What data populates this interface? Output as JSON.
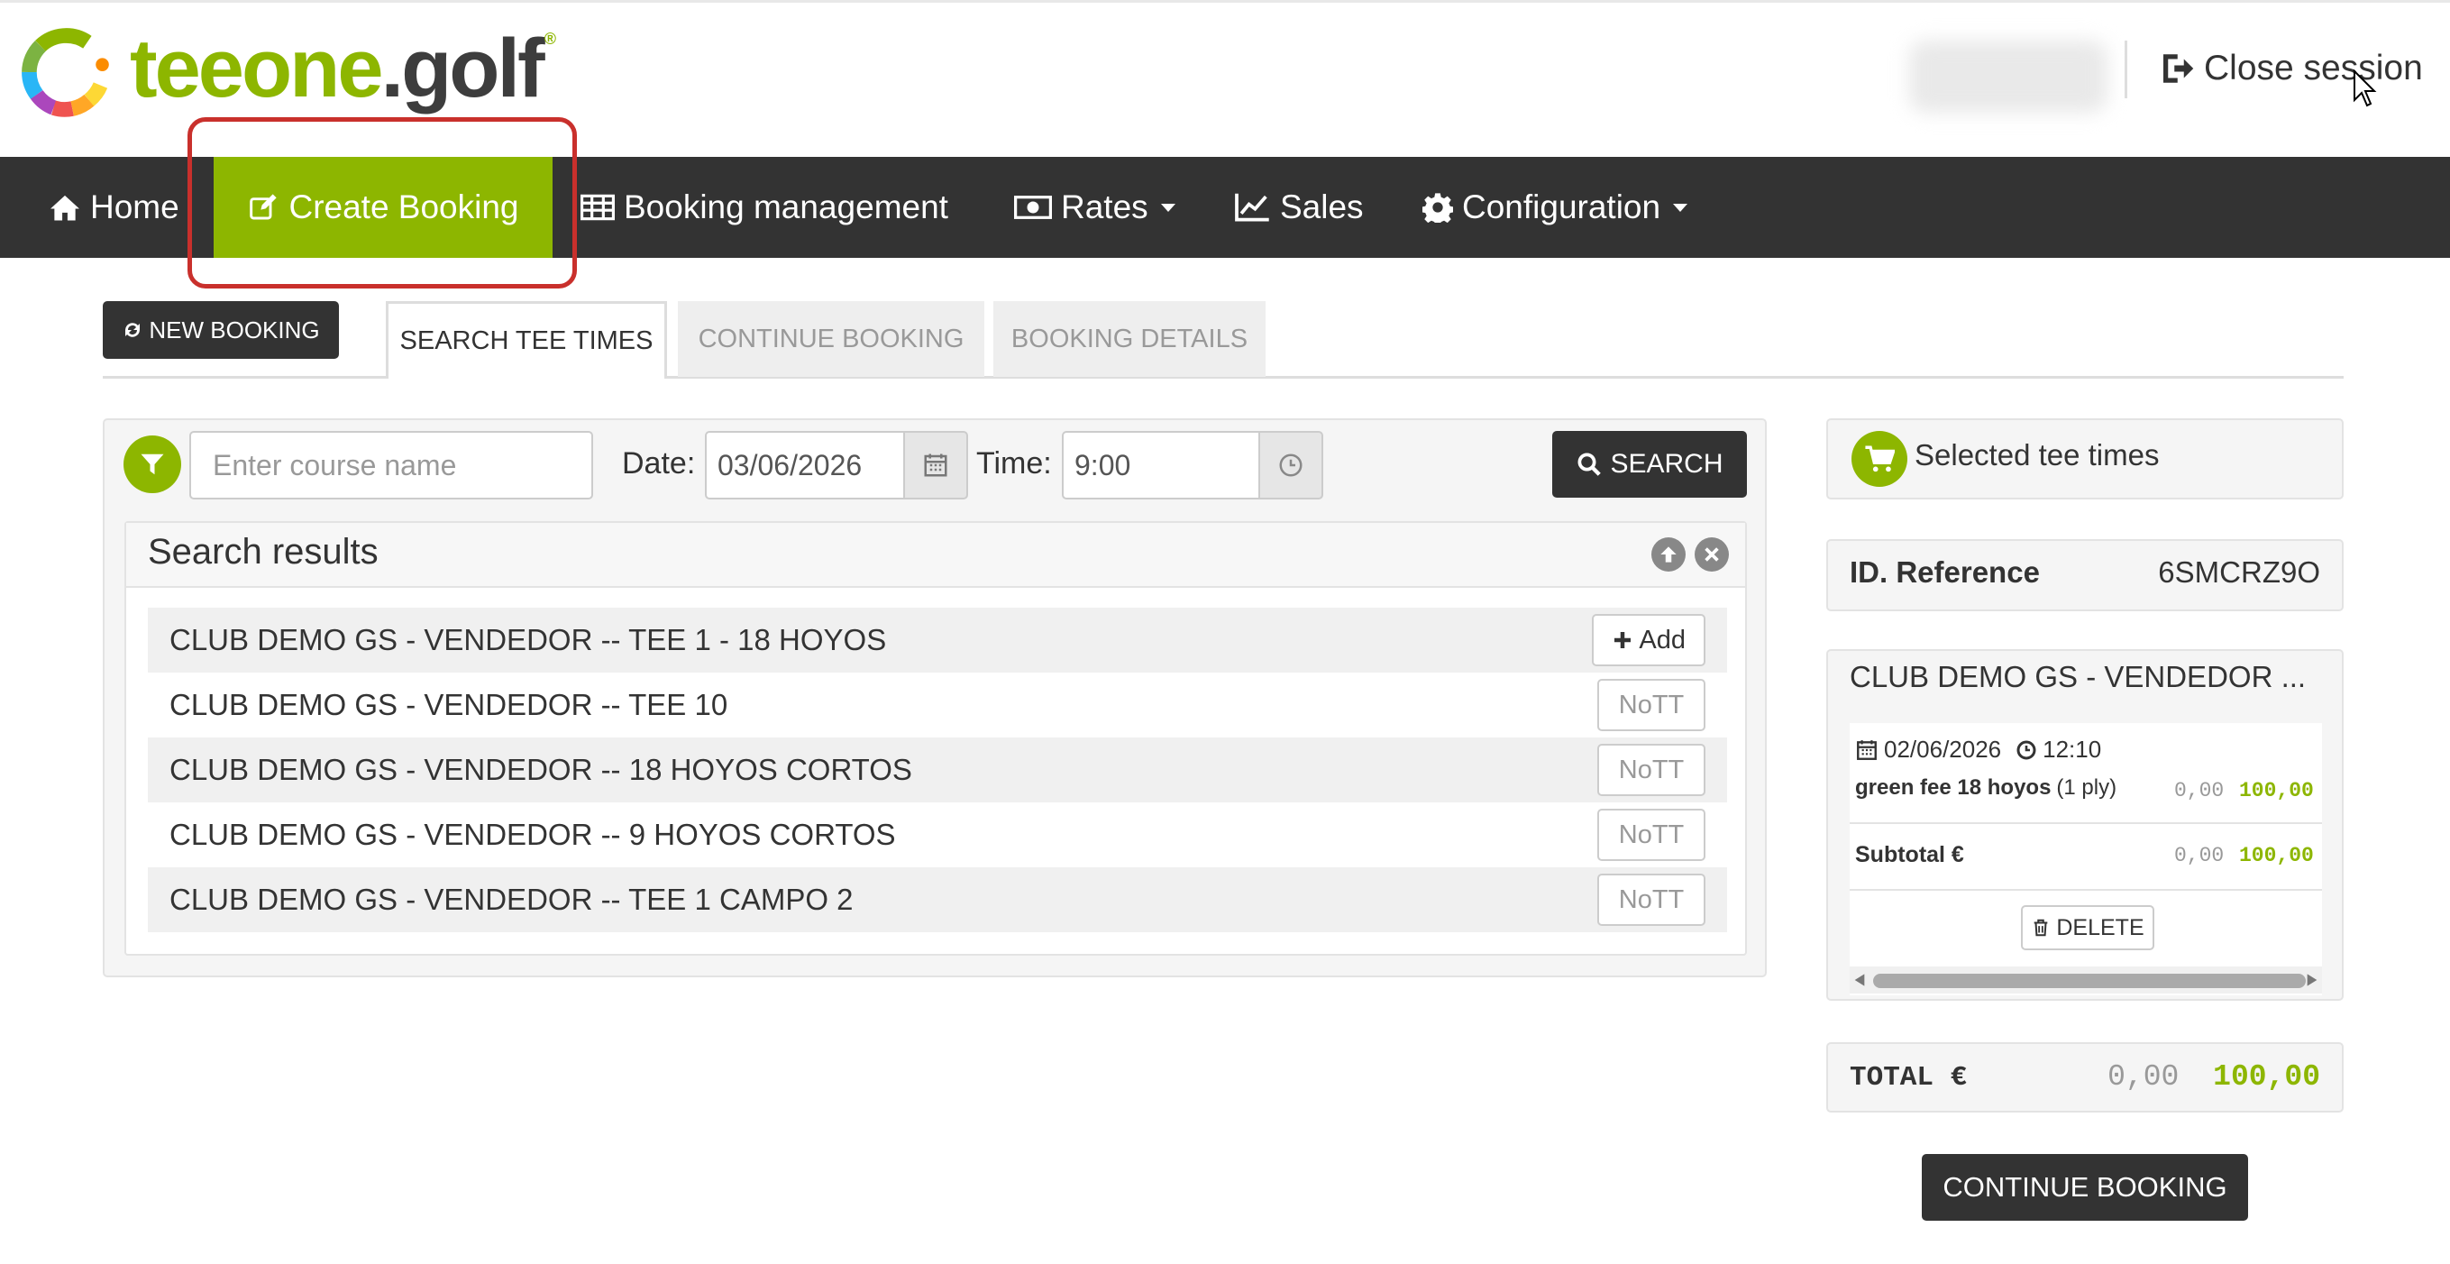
{
  "header": {
    "logo_part1": "teeone",
    "logo_part2": ".golf",
    "logo_reg": "®",
    "close_session": "Close session"
  },
  "nav": {
    "items": [
      {
        "label": "Home"
      },
      {
        "label": "Create Booking"
      },
      {
        "label": "Booking management"
      },
      {
        "label": "Rates"
      },
      {
        "label": "Sales"
      },
      {
        "label": "Configuration"
      }
    ]
  },
  "toolbar": {
    "new_booking": "NEW BOOKING",
    "tabs": [
      "SEARCH TEE TIMES",
      "CONTINUE BOOKING",
      "BOOKING DETAILS"
    ]
  },
  "search": {
    "course_placeholder": "Enter course name",
    "date_label": "Date:",
    "date_value": "03/06/2026",
    "time_label": "Time:",
    "time_value": "9:00",
    "search_button": "SEARCH"
  },
  "results": {
    "title": "Search results",
    "rows": [
      {
        "name": "CLUB DEMO GS - VENDEDOR -- TEE 1 - 18 HOYOS",
        "action": "Add"
      },
      {
        "name": "CLUB DEMO GS - VENDEDOR -- TEE 10",
        "action": "NoTT"
      },
      {
        "name": "CLUB DEMO GS - VENDEDOR -- 18 HOYOS CORTOS",
        "action": "NoTT"
      },
      {
        "name": "CLUB DEMO GS - VENDEDOR -- 9 HOYOS CORTOS",
        "action": "NoTT"
      },
      {
        "name": "CLUB DEMO GS - VENDEDOR -- TEE 1 CAMPO 2",
        "action": "NoTT"
      }
    ]
  },
  "cart": {
    "title": "Selected tee times",
    "id_label": "ID. Reference",
    "id_value": "6SMCRZ9O",
    "club": "CLUB DEMO GS - VENDEDOR ...",
    "date": "02/06/2026",
    "time": "12:10",
    "item_label": "green fee 18 hoyos",
    "item_qty": "(1 ply)",
    "item_discount": "0,00",
    "item_price": "100,00",
    "subtotal_label": "Subtotal €",
    "subtotal_discount": "0,00",
    "subtotal_price": "100,00",
    "delete_button": "DELETE",
    "total_label": "TOTAL €",
    "total_discount": "0,00",
    "total_price": "100,00",
    "continue_button": "CONTINUE BOOKING"
  },
  "colors": {
    "brand_green": "#8db600",
    "navbar": "#333333",
    "highlight_red": "#c9302c"
  }
}
